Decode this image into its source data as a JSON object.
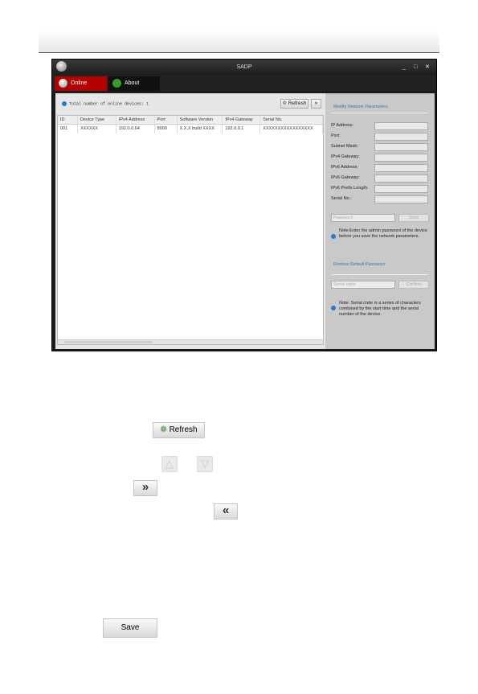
{
  "window": {
    "title": "SADP",
    "controls": "_ □ ✕"
  },
  "tabs": [
    {
      "label": "Online Devices"
    },
    {
      "label": "About"
    }
  ],
  "info": {
    "label": "Total number of online devices:",
    "count": "1"
  },
  "toolbar": {
    "refresh": "Refresh",
    "expand": "»"
  },
  "table": {
    "columns": [
      "ID",
      "Device Type",
      "IPv4 Address",
      "Port",
      "Software Version",
      "IPv4 Gateway",
      "Serial No."
    ],
    "rows": [
      [
        "001",
        "XXXXXX",
        "192.0.0.64",
        "8000",
        "X.X.X build XXXX",
        "192.0.0.1",
        "XXXXXXXXXXXXXXXXX"
      ]
    ]
  },
  "modify": {
    "title": "Modify Network Parameters",
    "fields": [
      "IP Address:",
      "Port:",
      "Subnet Mask:",
      "IPv4 Gateway:",
      "IPv6 Address:",
      "IPv6 Gateway:",
      "IPv6 Prefix Length:",
      "Serial No.:"
    ],
    "password_placeholder": "Password",
    "save": "Save",
    "note": "Note:Enter the admin password of the device before you save the network parameters."
  },
  "restore": {
    "title": "Restore Default Password",
    "code_placeholder": "Serial code",
    "confirm": "Confirm",
    "note": "Note: Serial code is a series of characters combined by the start time and the serial number of the device."
  },
  "doc": {
    "refresh": "Refresh",
    "up": "△",
    "down": "▽",
    "expand": "»",
    "collapse": "«",
    "save": "Save"
  }
}
